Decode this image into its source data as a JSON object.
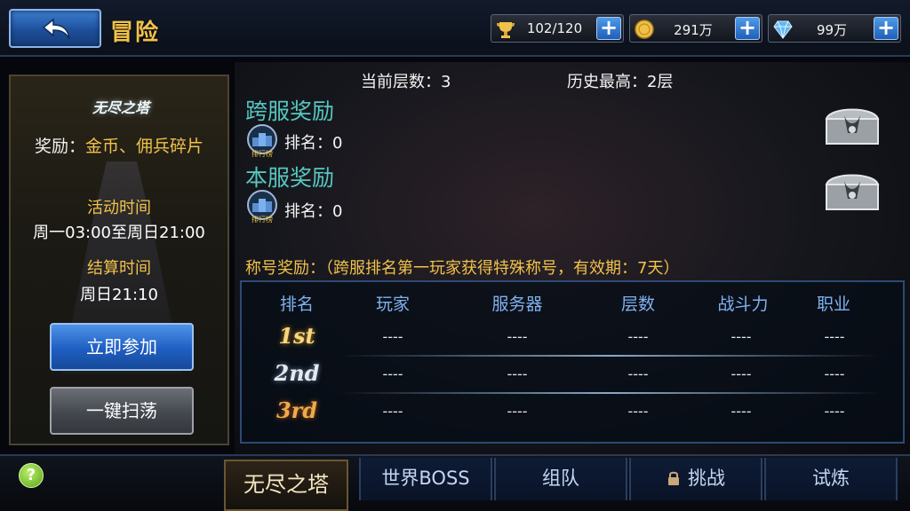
{
  "header": {
    "title": "冒险",
    "resources": [
      {
        "icon": "trophy-icon",
        "value": "102/120"
      },
      {
        "icon": "gold-coin-icon",
        "value": "291万"
      },
      {
        "icon": "diamond-icon",
        "value": "99万"
      }
    ]
  },
  "left_panel": {
    "logo_text": "无尽之塔",
    "reward_prefix": "奖励：",
    "reward_items": "金币、佣兵碎片",
    "activity_time_label": "活动时间",
    "activity_time_value": "周一03:00至周日21:00",
    "settle_time_label": "结算时间",
    "settle_time_value": "周日21:10",
    "join_button": "立即参加",
    "sweep_button": "一键扫荡"
  },
  "main": {
    "current_floor": "当前层数：3",
    "history_best": "历史最高：2层",
    "cross_server_reward": "跨服奖励",
    "cross_server_rank": "排名：0",
    "local_server_reward": "本服奖励",
    "local_server_rank": "排名：0",
    "rank_badge_label": "排行榜",
    "title_reward": "称号奖励：（跨服排名第一玩家获得特殊称号，有效期：7天）"
  },
  "table": {
    "headers": [
      "排名",
      "玩家",
      "服务器",
      "层数",
      "战斗力",
      "职业"
    ],
    "rows": [
      {
        "rank": "1st",
        "player": "----",
        "server": "----",
        "floors": "----",
        "power": "----",
        "class": "----"
      },
      {
        "rank": "2nd",
        "player": "----",
        "server": "----",
        "floors": "----",
        "power": "----",
        "class": "----"
      },
      {
        "rank": "3rd",
        "player": "----",
        "server": "----",
        "floors": "----",
        "power": "----",
        "class": "----"
      }
    ]
  },
  "tabs": [
    {
      "label": "无尽之塔",
      "active": true
    },
    {
      "label": "世界BOSS",
      "active": false
    },
    {
      "label": "组队",
      "active": false
    },
    {
      "label": "挑战",
      "active": false,
      "locked": true
    },
    {
      "label": "试炼",
      "active": false
    }
  ],
  "help_label": "?"
}
